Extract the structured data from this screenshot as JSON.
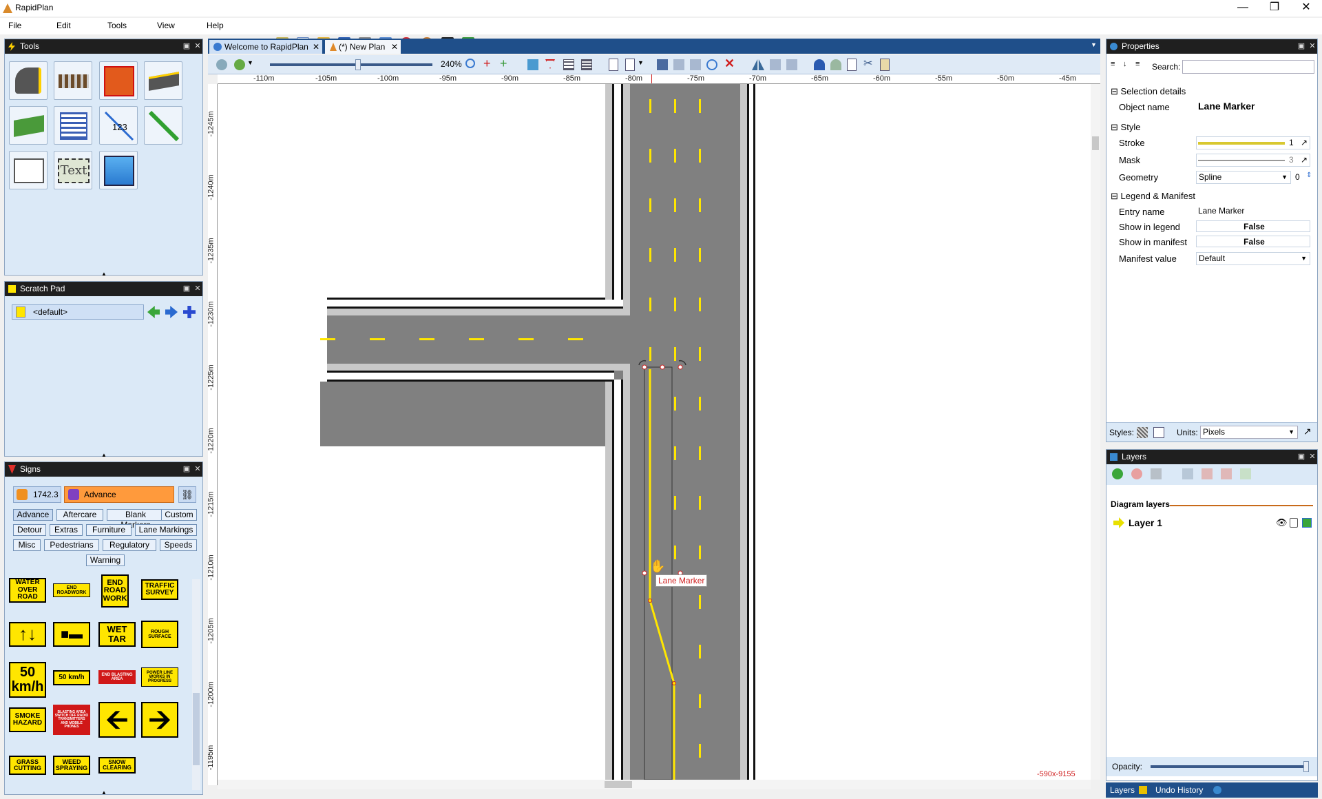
{
  "app": {
    "title": "RapidPlan"
  },
  "menu": [
    "File",
    "Edit",
    "Tools",
    "View",
    "Help"
  ],
  "panels": {
    "tools": "Tools",
    "scratch": "Scratch Pad",
    "signs": "Signs",
    "properties": "Properties",
    "layers": "Layers"
  },
  "scratch": {
    "selected": "<default>"
  },
  "signs": {
    "version": "1742.3",
    "category": "Advance",
    "tabs": [
      "Advance",
      "Aftercare",
      "Blank Markers",
      "Custom",
      "Detour",
      "Extras",
      "Furniture",
      "Lane Markings",
      "Misc",
      "Pedestrians",
      "Regulatory",
      "Speeds",
      "Warning"
    ],
    "items": [
      "WATER OVER ROAD",
      "END ROADWORK",
      "END ROAD WORK",
      "TRAFFIC SURVEY",
      "WET TAR",
      "ROUGH SURFACE",
      "50 km/h",
      "50 km/h",
      "END BLASTING AREA",
      "POWER LINE WORKS IN PROGRESS",
      "SMOKE HAZARD",
      "BLASTING AREA SWITCH OFF RADIO TRANSMITTERS AND MOBILE PHONES",
      "GRASS CUTTING",
      "WEED SPRAYING",
      "SNOW CLEARING"
    ]
  },
  "doc_tabs": [
    {
      "label": "Welcome to RapidPlan"
    },
    {
      "label": "(*) New Plan"
    }
  ],
  "canvas_toolbar": {
    "zoom": "240%"
  },
  "ruler_h": [
    "-110m",
    "-105m",
    "-100m",
    "-95m",
    "-90m",
    "-85m",
    "-80m",
    "-75m",
    "-70m",
    "-65m",
    "-60m",
    "-55m",
    "-50m",
    "-45m"
  ],
  "ruler_v": [
    "-1245m",
    "-1240m",
    "-1235m",
    "-1230m",
    "-1225m",
    "-1220m",
    "-1215m",
    "-1210m",
    "-1205m",
    "-1200m",
    "-1195m"
  ],
  "canvas": {
    "tooltip": "Lane Marker",
    "coords": "-590x-9155"
  },
  "properties": {
    "search_label": "Search:",
    "search_value": "",
    "sections": {
      "selection": "Selection details",
      "style": "Style",
      "legend": "Legend & Manifest"
    },
    "object_name_label": "Object name",
    "object_name": "Lane Marker",
    "stroke_label": "Stroke",
    "stroke_value": "1",
    "mask_label": "Mask",
    "mask_value": "3",
    "geometry_label": "Geometry",
    "geometry_value": "Spline",
    "geometry_num": "0",
    "entry_name_label": "Entry name",
    "entry_name": "Lane Marker",
    "show_legend_label": "Show in legend",
    "show_legend": "False",
    "show_manifest_label": "Show in manifest",
    "show_manifest": "False",
    "manifest_value_label": "Manifest value",
    "manifest_value": "Default",
    "styles_label": "Styles:",
    "units_label": "Units:",
    "units_value": "Pixels"
  },
  "layers": {
    "heading": "Diagram layers",
    "items": [
      {
        "name": "Layer 1"
      }
    ],
    "opacity_label": "Opacity:"
  },
  "bottom_tabs": [
    "Layers",
    "Undo History"
  ],
  "colors": {
    "road": "#808080",
    "marking": "#ffe600",
    "panel": "#dbe9f7",
    "header": "#1f1f1f",
    "accent": "#ff8a2a"
  }
}
